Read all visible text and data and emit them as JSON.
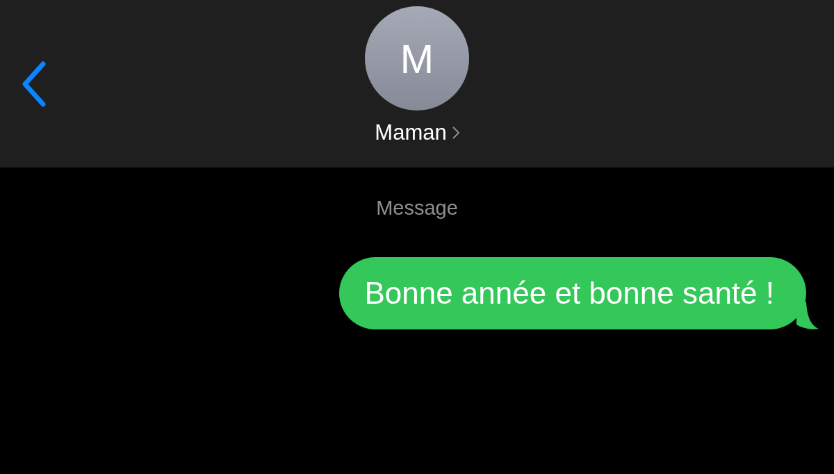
{
  "header": {
    "contact": {
      "initial": "M",
      "name": "Maman"
    }
  },
  "service_label": "Message",
  "messages": [
    {
      "kind": "sent",
      "text": "Bonne année et bonne santé !"
    }
  ]
}
